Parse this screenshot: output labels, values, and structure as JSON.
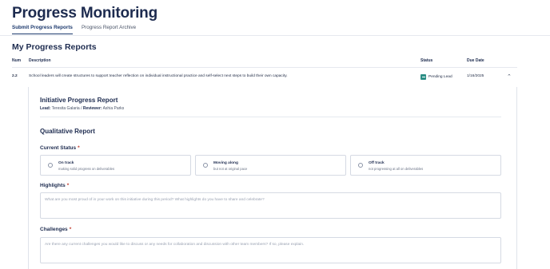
{
  "header": {
    "title": "Progress Monitoring",
    "tabs": [
      {
        "label": "Submit Progress Reports",
        "active": true
      },
      {
        "label": "Progress Report Archive",
        "active": false
      }
    ]
  },
  "reports": {
    "title": "My Progress Reports",
    "columns": {
      "num": "Num",
      "description": "Description",
      "status": "Status",
      "due_date": "Due Date"
    },
    "rows": [
      {
        "num": "2.2",
        "description": "School leaders will create structures to support teacher reflection on individual instructional practice and self-select next steps to build their own capacity.",
        "status": "Pending Lead",
        "status_icon": "arrow-right-icon",
        "due_date": "1/16/2025",
        "expanded": true
      }
    ]
  },
  "initiative": {
    "title": "Initiative Progress Report",
    "lead_label": "Lead:",
    "lead_name": "Teresita Galaria",
    "separator": "/",
    "reviewer_label": "Reviewer:",
    "reviewer_name": "Ashia Parks"
  },
  "qualitative": {
    "title": "Qualitative Report",
    "current_status": {
      "label": "Current Status",
      "required": "*",
      "options": [
        {
          "title": "On track",
          "subtitle": "making solid progress on deliverables"
        },
        {
          "title": "Moving along",
          "subtitle": "but not at original pace"
        },
        {
          "title": "Off track",
          "subtitle": "not progressing at all on deliverables"
        }
      ]
    },
    "highlights": {
      "label": "Highlights",
      "required": "*",
      "placeholder": "What are you most proud of in your work on this initiative during this period? What highlights do you have to share and celebrate?"
    },
    "challenges": {
      "label": "Challenges",
      "required": "*",
      "placeholder": "Are there any current challenges you would like to discuss or any needs for collaboration and discussion with other team members? If so, please explain."
    }
  },
  "colors": {
    "accent": "#1d3a6e",
    "status_teal": "#2d8f86",
    "required_red": "#c0392b"
  }
}
